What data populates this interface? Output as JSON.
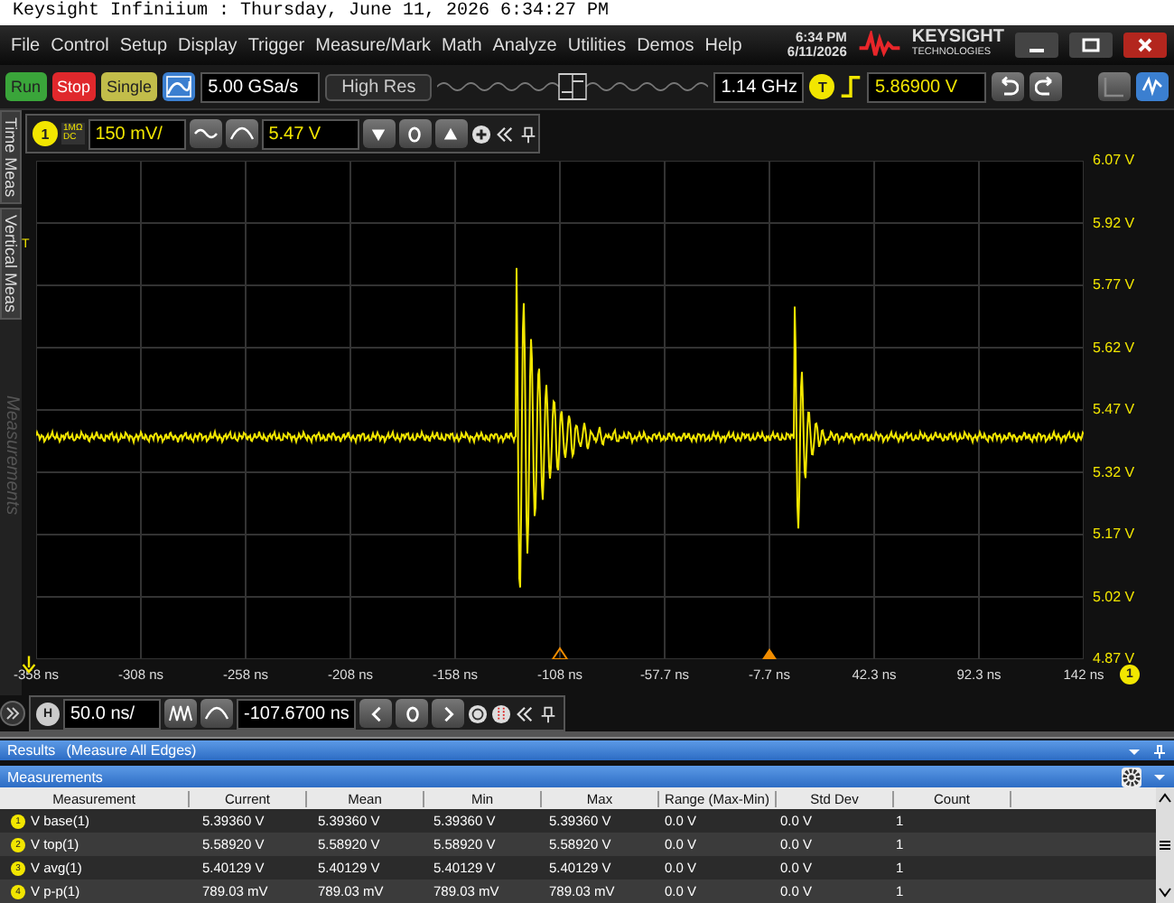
{
  "title_bar": {
    "title": "Keysight Infiniium : Thursday, June 11, 2026 6:34:27 PM"
  },
  "menu": [
    "File",
    "Control",
    "Setup",
    "Display",
    "Trigger",
    "Measure/Mark",
    "Math",
    "Analyze",
    "Utilities",
    "Demos",
    "Help"
  ],
  "clock": {
    "time": "6:34 PM",
    "date": "6/11/2026"
  },
  "logo": {
    "name": "KEYSIGHT",
    "tagline": "TECHNOLOGIES"
  },
  "acquisition": {
    "buttons": [
      {
        "label": "Run",
        "kind": "run"
      },
      {
        "label": "Stop",
        "kind": "stop"
      },
      {
        "label": "Single",
        "kind": "single"
      }
    ],
    "sample_rate": "5.00 GSa/s",
    "mode": "High Res",
    "bandwidth": "1.14 GHz",
    "trigger_source": "T",
    "trigger_level": "5.86900 V"
  },
  "side_tabs": [
    "Time Meas",
    "Vertical Meas"
  ],
  "collapsed_panel": "Measurements",
  "channel": {
    "number": "1",
    "impedance": "1MΩ",
    "coupling": "DC",
    "scale": "150 mV/",
    "offset": "5.47 V"
  },
  "graph": {
    "trigger_marker": "T",
    "channel_marker": "1",
    "y_labels": [
      "6.07 V",
      "5.92 V",
      "5.77 V",
      "5.62 V",
      "5.47 V",
      "5.32 V",
      "5.17 V",
      "5.02 V",
      "4.87 V"
    ],
    "x_labels": [
      "-358 ns",
      "-308 ns",
      "-258 ns",
      "-208 ns",
      "-158 ns",
      "-108 ns",
      "-57.7 ns",
      "-7.7 ns",
      "42.3 ns",
      "92.3 ns",
      "142 ns"
    ]
  },
  "horizontal": {
    "label": "H",
    "scale": "50.0 ns/",
    "position": "-107.6700 ns"
  },
  "results": {
    "title": "Results",
    "subtitle": "(Measure All Edges)"
  },
  "measurements": {
    "title": "Measurements",
    "columns": [
      "Measurement",
      "Current",
      "Mean",
      "Min",
      "Max",
      "Range (Max-Min)",
      "Std Dev",
      "Count"
    ],
    "rows": [
      {
        "marker": "1",
        "cells": [
          "V base(1)",
          "5.39360 V",
          "5.39360 V",
          "5.39360 V",
          "5.39360 V",
          "0.0 V",
          "0.0 V",
          "1"
        ]
      },
      {
        "marker": "2",
        "cells": [
          "V top(1)",
          "5.58920 V",
          "5.58920 V",
          "5.58920 V",
          "5.58920 V",
          "0.0 V",
          "0.0 V",
          "1"
        ]
      },
      {
        "marker": "3",
        "cells": [
          "V avg(1)",
          "5.40129 V",
          "5.40129 V",
          "5.40129 V",
          "5.40129 V",
          "0.0 V",
          "0.0 V",
          "1"
        ]
      },
      {
        "marker": "4",
        "cells": [
          "V p-p(1)",
          "789.03 mV",
          "789.03 mV",
          "789.03 mV",
          "789.03 mV",
          "0.0 V",
          "0.0 V",
          "1"
        ]
      }
    ]
  }
}
